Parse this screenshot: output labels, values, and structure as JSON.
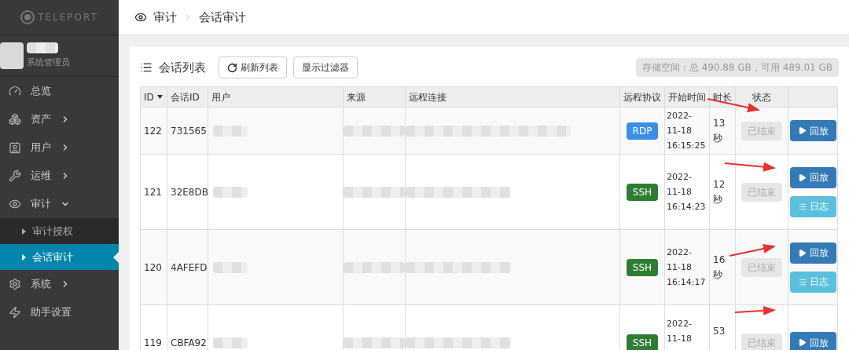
{
  "logo": {
    "text": "TELEPORT"
  },
  "user": {
    "role": "系统管理员"
  },
  "sidebar": {
    "items": [
      {
        "label": "总览",
        "selected": false
      },
      {
        "label": "资产",
        "selected": false,
        "expanded": false
      },
      {
        "label": "用户",
        "selected": false,
        "expanded": false
      },
      {
        "label": "运维",
        "selected": false,
        "expanded": false
      },
      {
        "label": "审计",
        "selected": false,
        "expanded": true,
        "children": [
          {
            "label": "审计授权",
            "selected": false
          },
          {
            "label": "会话审计",
            "selected": true
          }
        ]
      },
      {
        "label": "系统",
        "selected": false,
        "expanded": false
      },
      {
        "label": "助手设置",
        "selected": false
      }
    ]
  },
  "breadcrumb": [
    "审计",
    "会话审计"
  ],
  "panel": {
    "title": "会话列表",
    "buttons": [
      {
        "kind": "refresh",
        "label": "刷新列表"
      },
      {
        "kind": "plain",
        "label": "显示过滤器"
      }
    ],
    "storage": "存储空间：总 490.88 GB，可用 489.01 GB"
  },
  "table": {
    "columns": [
      "ID",
      "会话ID",
      "用户",
      "来源",
      "远程连接",
      "远程协议",
      "开始时间",
      "时长",
      "状态"
    ],
    "rows": [
      {
        "id": "122",
        "session": "731565",
        "protocol": {
          "kind": "rdp",
          "label": "RDP"
        },
        "start": [
          "2022-",
          "11-18",
          "16:15:25"
        ],
        "duration": [
          "13",
          "秒"
        ],
        "status": "已结束",
        "actions": [
          {
            "kind": "play",
            "label": "回放"
          }
        ]
      },
      {
        "id": "121",
        "session": "32E8DB",
        "protocol": {
          "kind": "ssh",
          "label": "SSH"
        },
        "start": [
          "2022-",
          "11-18",
          "16:14:23"
        ],
        "duration": [
          "12",
          "秒"
        ],
        "status": "已结束",
        "actions": [
          {
            "kind": "play",
            "label": "回放"
          },
          {
            "kind": "log",
            "label": "日志"
          }
        ]
      },
      {
        "id": "120",
        "session": "4AFEFD",
        "protocol": {
          "kind": "ssh",
          "label": "SSH"
        },
        "start": [
          "2022-",
          "11-18",
          "16:14:17"
        ],
        "duration": [
          "16",
          "秒"
        ],
        "status": "已结束",
        "actions": [
          {
            "kind": "play",
            "label": "回放"
          },
          {
            "kind": "log",
            "label": "日志"
          }
        ]
      },
      {
        "id": "119",
        "session": "CBFA92",
        "protocol": {
          "kind": "ssh",
          "label": "SSH"
        },
        "start": [
          "2022-",
          "11-18"
        ],
        "duration": [
          "53"
        ],
        "status": "已结束",
        "actions": [
          {
            "kind": "play",
            "label": "回放"
          }
        ]
      }
    ]
  }
}
